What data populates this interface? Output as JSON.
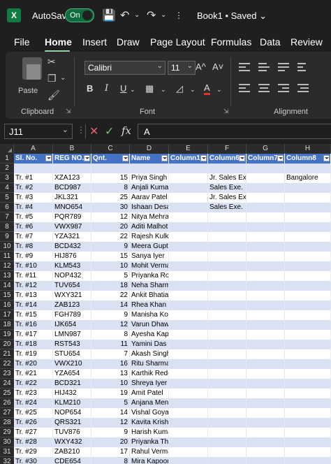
{
  "titlebar": {
    "app_icon": "excel-logo",
    "app_letter": "X",
    "autosave_label": "AutoSave",
    "autosave_state": "On",
    "doc_title": "Book1 • Saved",
    "chevron": "⌄",
    "icons": [
      "save-icon",
      "undo-icon",
      "redo-icon"
    ]
  },
  "tabs": [
    "File",
    "Home",
    "Insert",
    "Draw",
    "Page Layout",
    "Formulas",
    "Data",
    "Review"
  ],
  "active_tab": "Home",
  "ribbon": {
    "paste_label": "Paste",
    "clipboard_label": "Clipboard",
    "font_label": "Font",
    "alignment_label": "Alignment",
    "font_name": "Calibri",
    "font_size": "11",
    "grow_font": "A^",
    "shrink_font": "A˅",
    "bold": "B",
    "italic": "I",
    "underline": "U",
    "font_color_letter": "A",
    "accent_red": "#e03030",
    "right_partial": "Ab"
  },
  "formula_bar": {
    "name_box": "J11",
    "cancel": "✕",
    "enter": "✓",
    "fx": "fx",
    "value": "A"
  },
  "columns": [
    "A",
    "B",
    "C",
    "D",
    "E",
    "F",
    "G",
    "H"
  ],
  "header_row": [
    "Sl. No.",
    "REG NO.",
    "Qnt.",
    "Name",
    "Column1",
    "Column6",
    "Column7",
    "Column8"
  ],
  "rows": [
    [
      "Tr. #1",
      "XZA123",
      "15",
      "Priya Singh",
      "",
      "Jr. Sales Exe.",
      "",
      "Bangalore"
    ],
    [
      "Tr. #2",
      "BCD987",
      "8",
      "Anjali Kumar",
      "",
      "Sales Exe.",
      "",
      ""
    ],
    [
      "Tr. #3",
      "JKL321",
      "25",
      "Aarav Patel",
      "",
      "Jr. Sales Exe.",
      "",
      ""
    ],
    [
      "Tr. #4",
      "MNO654",
      "30",
      "Ishaan Desai",
      "",
      "Sales Exe.",
      "",
      ""
    ],
    [
      "Tr. #5",
      "PQR789",
      "12",
      "Nitya Mehra",
      "",
      "",
      "",
      ""
    ],
    [
      "Tr. #6",
      "VWX987",
      "20",
      "Aditi Malhotra",
      "",
      "",
      "",
      ""
    ],
    [
      "Tr. #7",
      "YZA321",
      "22",
      "Rajesh Kulkarni",
      "",
      "",
      "",
      ""
    ],
    [
      "Tr. #8",
      "BCD432",
      "9",
      "Meera Gupta",
      "",
      "",
      "",
      ""
    ],
    [
      "Tr. #9",
      "HIJ876",
      "15",
      "Sanya Iyer",
      "",
      "",
      "",
      ""
    ],
    [
      "Tr. #10",
      "KLM543",
      "10",
      "Mohit Verma",
      "",
      "",
      "",
      ""
    ],
    [
      "Tr. #11",
      "NOP432",
      "5",
      "Priyanka Roy",
      "",
      "",
      "",
      ""
    ],
    [
      "Tr. #12",
      "TUV654",
      "18",
      "Neha Sharma",
      "",
      "",
      "",
      ""
    ],
    [
      "Tr. #13",
      "WXY321",
      "22",
      "Ankit Bhatia",
      "",
      "",
      "",
      ""
    ],
    [
      "Tr. #14",
      "ZAB123",
      "14",
      "Rhea Khan",
      "",
      "",
      "",
      ""
    ],
    [
      "Tr. #15",
      "FGH789",
      "9",
      "Manisha Koirala",
      "",
      "",
      "",
      ""
    ],
    [
      "Tr. #16",
      "IJK654",
      "12",
      "Varun Dhawan",
      "",
      "",
      "",
      ""
    ],
    [
      "Tr. #17",
      "LMN987",
      "8",
      "Ayesha Kapoor",
      "",
      "",
      "",
      ""
    ],
    [
      "Tr. #18",
      "RST543",
      "11",
      "Yamini Das",
      "",
      "",
      "",
      ""
    ],
    [
      "Tr. #19",
      "STU654",
      "7",
      "Akash Singh",
      "",
      "",
      "",
      ""
    ],
    [
      "Tr. #20",
      "VWX210",
      "16",
      "Ritu Sharma",
      "",
      "",
      "",
      ""
    ],
    [
      "Tr. #21",
      "YZA654",
      "13",
      "Karthik Reddy",
      "",
      "",
      "",
      ""
    ],
    [
      "Tr. #22",
      "BCD321",
      "10",
      "Shreya Iyer",
      "",
      "",
      "",
      ""
    ],
    [
      "Tr. #23",
      "HIJ432",
      "19",
      "Amit Patel",
      "",
      "",
      "",
      ""
    ],
    [
      "Tr. #24",
      "KLM210",
      "5",
      "Anjana Menon",
      "",
      "",
      "",
      ""
    ],
    [
      "Tr. #25",
      "NOP654",
      "14",
      "Vishal Goyal",
      "",
      "",
      "",
      ""
    ],
    [
      "Tr. #26",
      "QRS321",
      "12",
      "Kavita Krishnan",
      "",
      "",
      "",
      ""
    ],
    [
      "Tr. #27",
      "TUV876",
      "9",
      "Harish Kumar",
      "",
      "",
      "",
      ""
    ],
    [
      "Tr. #28",
      "WXY432",
      "20",
      "Priyanka Thakur",
      "",
      "",
      "",
      ""
    ],
    [
      "Tr. #29",
      "ZAB210",
      "17",
      "Rahul Verma",
      "",
      "",
      "",
      ""
    ],
    [
      "Tr. #30",
      "CDE654",
      "8",
      "Mira Kapoor",
      "",
      "",
      "",
      ""
    ]
  ],
  "colors": {
    "header_blue": "#4472c4",
    "band_light": "#d9e1f2",
    "band_white": "#ffffff",
    "excel_green": "#107c41"
  }
}
